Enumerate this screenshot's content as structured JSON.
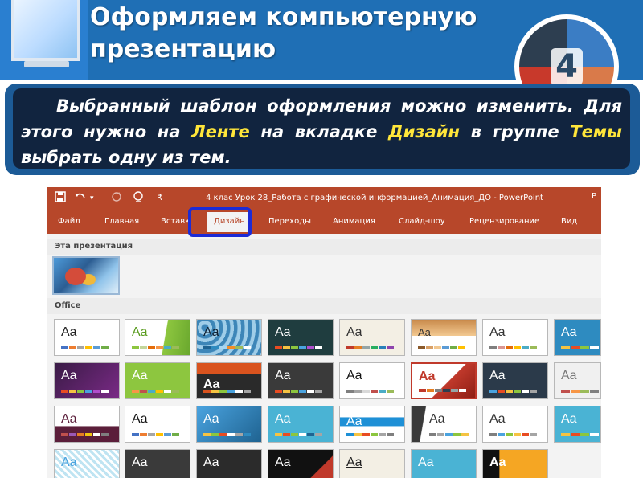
{
  "slide": {
    "title": "Оформляем компьютерную презентацию",
    "badge_number": "4",
    "callout": {
      "part1": "Выбранный шаблон оформления можно изменить. Для этого нужно на ",
      "hl1": "Ленте",
      "part2": " на вкладке ",
      "hl2": "Дизайн",
      "part3": " в группе ",
      "hl3": "Темы",
      "part4": " выбрать одну из тем."
    }
  },
  "ppt": {
    "doc_title": "4 клас Урок 28_Работа с графической информацией_Анимация_ДО - PowerPoint",
    "title_right": "Р",
    "qat": {
      "save_icon": "save-icon",
      "undo_icon": "undo-icon",
      "redo_icon": "redo-icon",
      "present_icon": "slideshow-icon",
      "customize_icon": "qat-customize-icon"
    },
    "tabs": [
      "Файл",
      "Главная",
      "Вставк",
      "Дизайн",
      "Переходы",
      "Анимация",
      "Слайд-шоу",
      "Рецензирование",
      "Вид"
    ],
    "active_tab": "Дизайн",
    "gallery": {
      "this_presentation": "Эта презентация",
      "office": "Office",
      "aa": "Aa"
    }
  }
}
